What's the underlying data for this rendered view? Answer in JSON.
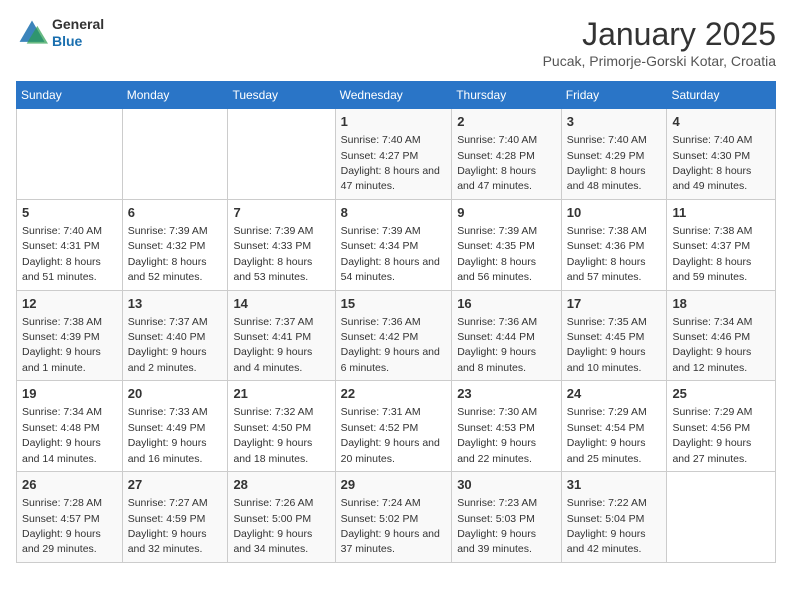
{
  "logo": {
    "general": "General",
    "blue": "Blue"
  },
  "title": "January 2025",
  "subtitle": "Pucak, Primorje-Gorski Kotar, Croatia",
  "days_of_week": [
    "Sunday",
    "Monday",
    "Tuesday",
    "Wednesday",
    "Thursday",
    "Friday",
    "Saturday"
  ],
  "weeks": [
    [
      {
        "day": "",
        "info": ""
      },
      {
        "day": "",
        "info": ""
      },
      {
        "day": "",
        "info": ""
      },
      {
        "day": "1",
        "info": "Sunrise: 7:40 AM\nSunset: 4:27 PM\nDaylight: 8 hours and 47 minutes."
      },
      {
        "day": "2",
        "info": "Sunrise: 7:40 AM\nSunset: 4:28 PM\nDaylight: 8 hours and 47 minutes."
      },
      {
        "day": "3",
        "info": "Sunrise: 7:40 AM\nSunset: 4:29 PM\nDaylight: 8 hours and 48 minutes."
      },
      {
        "day": "4",
        "info": "Sunrise: 7:40 AM\nSunset: 4:30 PM\nDaylight: 8 hours and 49 minutes."
      }
    ],
    [
      {
        "day": "5",
        "info": "Sunrise: 7:40 AM\nSunset: 4:31 PM\nDaylight: 8 hours and 51 minutes."
      },
      {
        "day": "6",
        "info": "Sunrise: 7:39 AM\nSunset: 4:32 PM\nDaylight: 8 hours and 52 minutes."
      },
      {
        "day": "7",
        "info": "Sunrise: 7:39 AM\nSunset: 4:33 PM\nDaylight: 8 hours and 53 minutes."
      },
      {
        "day": "8",
        "info": "Sunrise: 7:39 AM\nSunset: 4:34 PM\nDaylight: 8 hours and 54 minutes."
      },
      {
        "day": "9",
        "info": "Sunrise: 7:39 AM\nSunset: 4:35 PM\nDaylight: 8 hours and 56 minutes."
      },
      {
        "day": "10",
        "info": "Sunrise: 7:38 AM\nSunset: 4:36 PM\nDaylight: 8 hours and 57 minutes."
      },
      {
        "day": "11",
        "info": "Sunrise: 7:38 AM\nSunset: 4:37 PM\nDaylight: 8 hours and 59 minutes."
      }
    ],
    [
      {
        "day": "12",
        "info": "Sunrise: 7:38 AM\nSunset: 4:39 PM\nDaylight: 9 hours and 1 minute."
      },
      {
        "day": "13",
        "info": "Sunrise: 7:37 AM\nSunset: 4:40 PM\nDaylight: 9 hours and 2 minutes."
      },
      {
        "day": "14",
        "info": "Sunrise: 7:37 AM\nSunset: 4:41 PM\nDaylight: 9 hours and 4 minutes."
      },
      {
        "day": "15",
        "info": "Sunrise: 7:36 AM\nSunset: 4:42 PM\nDaylight: 9 hours and 6 minutes."
      },
      {
        "day": "16",
        "info": "Sunrise: 7:36 AM\nSunset: 4:44 PM\nDaylight: 9 hours and 8 minutes."
      },
      {
        "day": "17",
        "info": "Sunrise: 7:35 AM\nSunset: 4:45 PM\nDaylight: 9 hours and 10 minutes."
      },
      {
        "day": "18",
        "info": "Sunrise: 7:34 AM\nSunset: 4:46 PM\nDaylight: 9 hours and 12 minutes."
      }
    ],
    [
      {
        "day": "19",
        "info": "Sunrise: 7:34 AM\nSunset: 4:48 PM\nDaylight: 9 hours and 14 minutes."
      },
      {
        "day": "20",
        "info": "Sunrise: 7:33 AM\nSunset: 4:49 PM\nDaylight: 9 hours and 16 minutes."
      },
      {
        "day": "21",
        "info": "Sunrise: 7:32 AM\nSunset: 4:50 PM\nDaylight: 9 hours and 18 minutes."
      },
      {
        "day": "22",
        "info": "Sunrise: 7:31 AM\nSunset: 4:52 PM\nDaylight: 9 hours and 20 minutes."
      },
      {
        "day": "23",
        "info": "Sunrise: 7:30 AM\nSunset: 4:53 PM\nDaylight: 9 hours and 22 minutes."
      },
      {
        "day": "24",
        "info": "Sunrise: 7:29 AM\nSunset: 4:54 PM\nDaylight: 9 hours and 25 minutes."
      },
      {
        "day": "25",
        "info": "Sunrise: 7:29 AM\nSunset: 4:56 PM\nDaylight: 9 hours and 27 minutes."
      }
    ],
    [
      {
        "day": "26",
        "info": "Sunrise: 7:28 AM\nSunset: 4:57 PM\nDaylight: 9 hours and 29 minutes."
      },
      {
        "day": "27",
        "info": "Sunrise: 7:27 AM\nSunset: 4:59 PM\nDaylight: 9 hours and 32 minutes."
      },
      {
        "day": "28",
        "info": "Sunrise: 7:26 AM\nSunset: 5:00 PM\nDaylight: 9 hours and 34 minutes."
      },
      {
        "day": "29",
        "info": "Sunrise: 7:24 AM\nSunset: 5:02 PM\nDaylight: 9 hours and 37 minutes."
      },
      {
        "day": "30",
        "info": "Sunrise: 7:23 AM\nSunset: 5:03 PM\nDaylight: 9 hours and 39 minutes."
      },
      {
        "day": "31",
        "info": "Sunrise: 7:22 AM\nSunset: 5:04 PM\nDaylight: 9 hours and 42 minutes."
      },
      {
        "day": "",
        "info": ""
      }
    ]
  ]
}
